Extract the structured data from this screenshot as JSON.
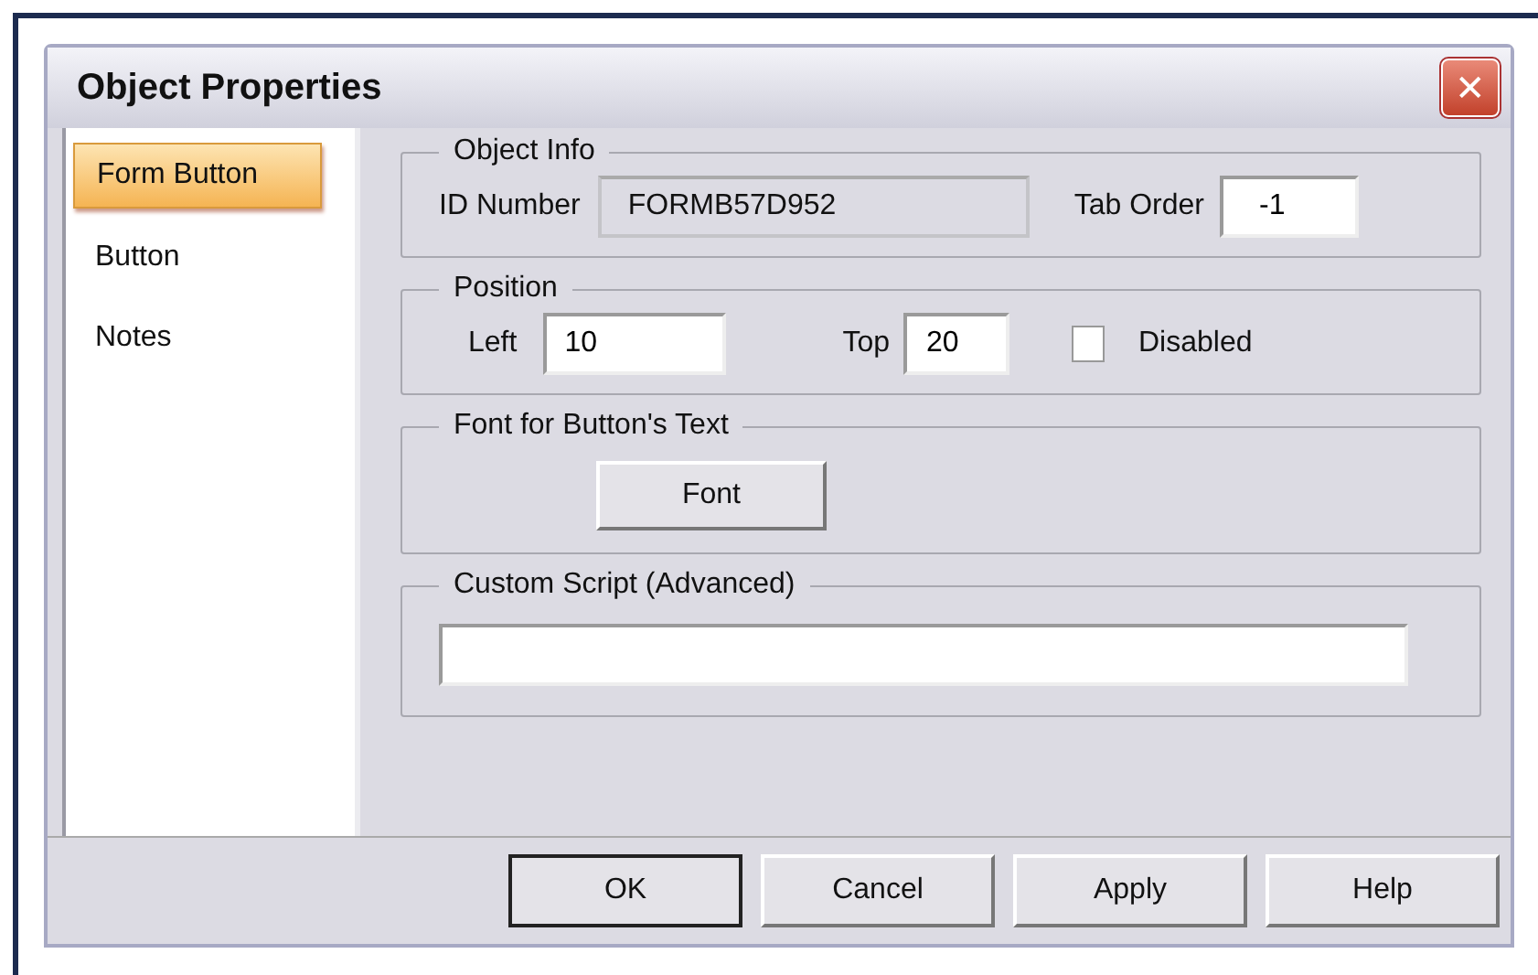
{
  "window": {
    "title": "Object Properties",
    "close": "✕"
  },
  "sidebar": {
    "items": [
      {
        "label": "Form Button",
        "selected": true
      },
      {
        "label": "Button",
        "selected": false
      },
      {
        "label": "Notes",
        "selected": false
      }
    ]
  },
  "object_info": {
    "legend": "Object Info",
    "id_label": "ID Number",
    "id_value": "FORMB57D952",
    "tab_order_label": "Tab Order",
    "tab_order_value": "-1"
  },
  "position": {
    "legend": "Position",
    "left_label": "Left",
    "left_value": "10",
    "top_label": "Top",
    "top_value": "20",
    "disabled_label": "Disabled",
    "disabled_checked": false
  },
  "font": {
    "legend": "Font for Button's Text",
    "button": "Font"
  },
  "script": {
    "legend": "Custom Script (Advanced)"
  },
  "buttons": [
    {
      "label": "OK",
      "default": true
    },
    {
      "label": "Cancel",
      "default": false
    },
    {
      "label": "Apply",
      "default": false
    },
    {
      "label": "Help",
      "default": false
    }
  ]
}
